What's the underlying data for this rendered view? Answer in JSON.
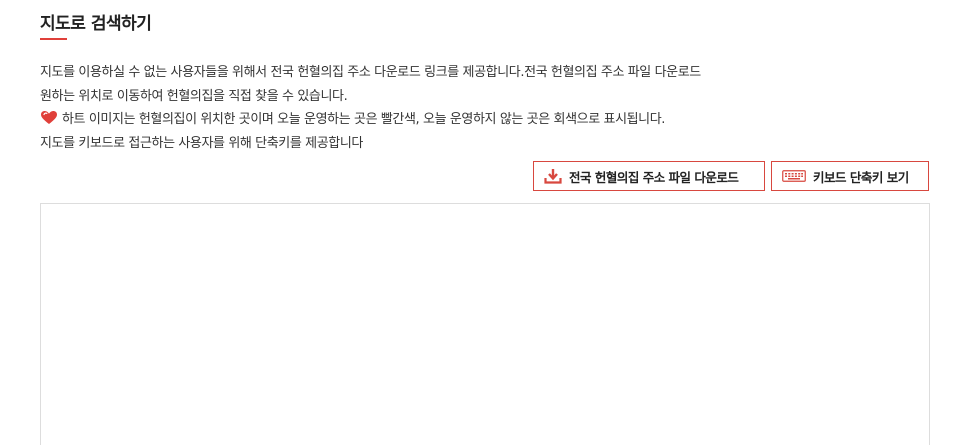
{
  "section": {
    "title": "지도로 검색하기"
  },
  "description": {
    "line1": "지도를 이용하실 수 없는 사용자들을 위해서 전국 헌혈의집 주소 다운로드 링크를 제공합니다.전국 헌혈의집 주소 파일 다운로드",
    "line2": "원하는 위치로 이동하여 헌혈의집을 직접 찾을 수 있습니다.",
    "line3": "하트 이미지는 헌혈의집이 위치한 곳이며 오늘 운영하는 곳은 빨간색, 오늘 운영하지 않는 곳은 회색으로 표시됩니다.",
    "line4": "지도를 키보드로 접근하는 사용자를 위해 단축키를 제공합니다"
  },
  "buttons": {
    "download_label": "전국 헌혈의집 주소 파일 다운로드",
    "keyboard_label": "키보드 단축키 보기"
  },
  "icons": {
    "heart": "heart-icon",
    "download": "download-icon",
    "keyboard": "keyboard-icon"
  },
  "colors": {
    "accent": "#e0403a",
    "border": "#d8483f"
  }
}
